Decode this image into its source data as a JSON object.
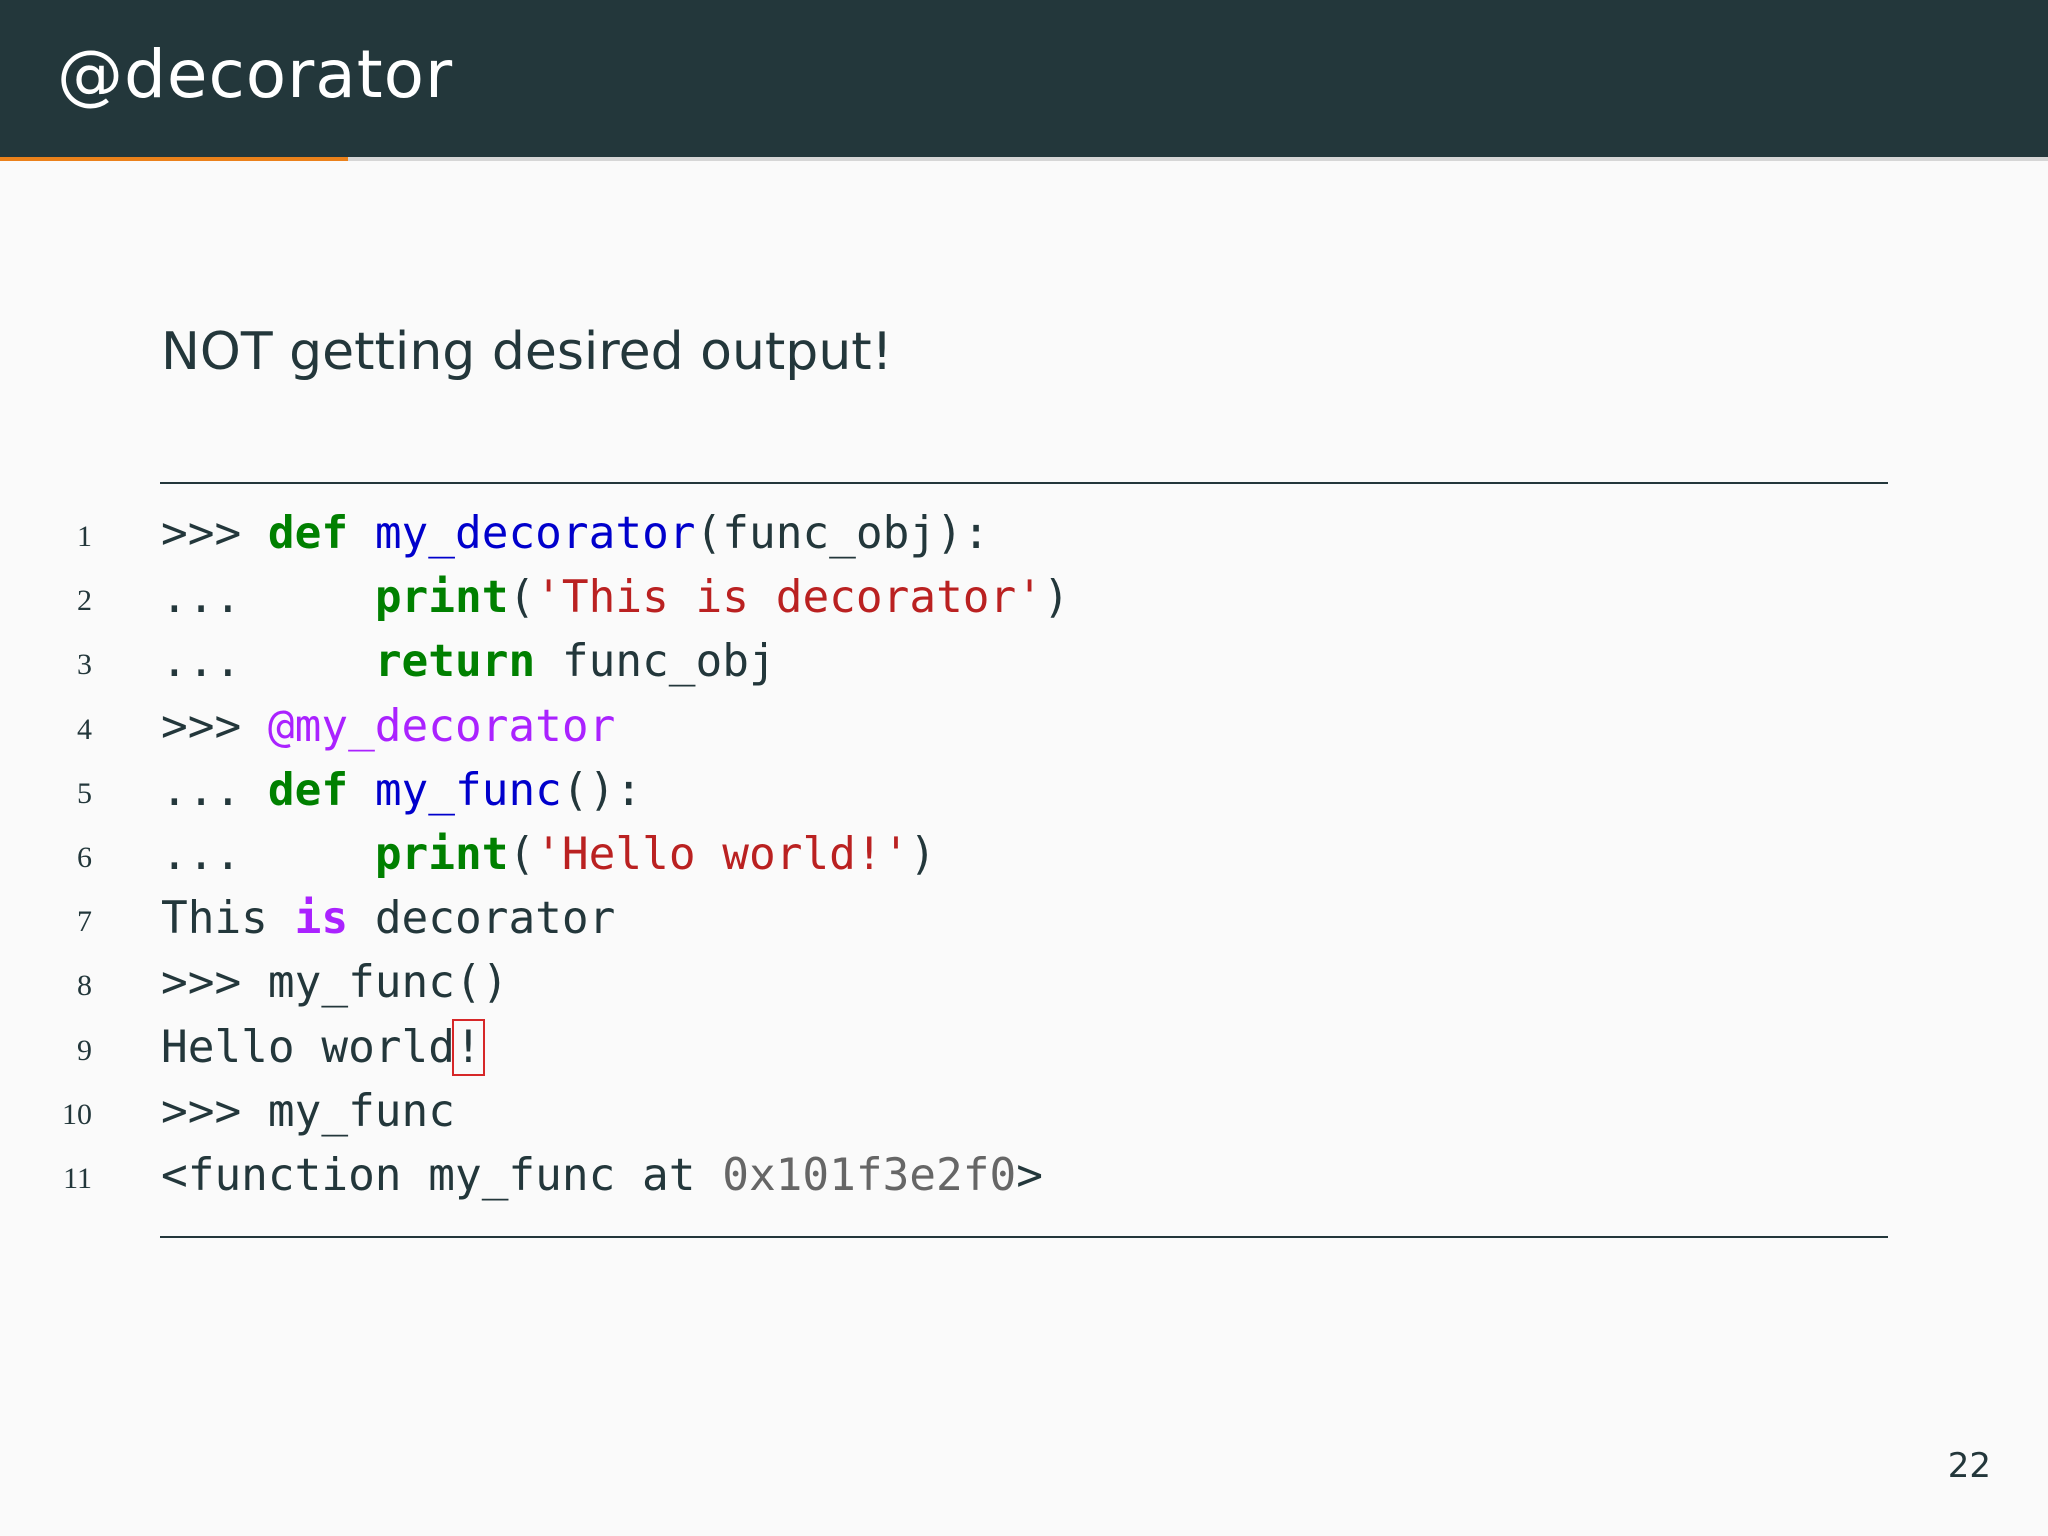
{
  "slide": {
    "title": "@decorator",
    "subtitle": "NOT getting desired output!",
    "page_number": "22",
    "progress": 0.17
  },
  "colors": {
    "header_bg": "#23373b",
    "progress_accent": "#eb811b",
    "keyword": "#008000",
    "function_name": "#0000cc",
    "string": "#ba2121",
    "decorator": "#aa22ff",
    "number": "#666666",
    "highlight_box": "#d62728"
  },
  "code": {
    "lines": [
      {
        "no": "1",
        "tokens": [
          {
            "t": "p",
            "v": ">>> "
          },
          {
            "t": "k",
            "v": "def"
          },
          {
            "t": "p",
            "v": " "
          },
          {
            "t": "n",
            "v": "my_decorator"
          },
          {
            "t": "p",
            "v": "(func_obj):"
          }
        ]
      },
      {
        "no": "2",
        "tokens": [
          {
            "t": "p",
            "v": "...     "
          },
          {
            "t": "k",
            "v": "print"
          },
          {
            "t": "p",
            "v": "("
          },
          {
            "t": "s",
            "v": "'This is decorator'"
          },
          {
            "t": "p",
            "v": ")"
          }
        ]
      },
      {
        "no": "3",
        "tokens": [
          {
            "t": "p",
            "v": "...     "
          },
          {
            "t": "k",
            "v": "return"
          },
          {
            "t": "p",
            "v": " func_obj"
          }
        ]
      },
      {
        "no": "4",
        "tokens": [
          {
            "t": "p",
            "v": ">>> "
          },
          {
            "t": "d",
            "v": "@my_decorator"
          }
        ]
      },
      {
        "no": "5",
        "tokens": [
          {
            "t": "p",
            "v": "... "
          },
          {
            "t": "k",
            "v": "def"
          },
          {
            "t": "p",
            "v": " "
          },
          {
            "t": "n",
            "v": "my_func"
          },
          {
            "t": "p",
            "v": "():"
          }
        ]
      },
      {
        "no": "6",
        "tokens": [
          {
            "t": "p",
            "v": "...     "
          },
          {
            "t": "k",
            "v": "print"
          },
          {
            "t": "p",
            "v": "("
          },
          {
            "t": "s",
            "v": "'Hello world!'"
          },
          {
            "t": "p",
            "v": ")"
          }
        ]
      },
      {
        "no": "7",
        "tokens": [
          {
            "t": "p",
            "v": "This "
          },
          {
            "t": "ow",
            "v": "is"
          },
          {
            "t": "p",
            "v": " decorator"
          }
        ]
      },
      {
        "no": "8",
        "tokens": [
          {
            "t": "p",
            "v": ">>> my_func()"
          }
        ]
      },
      {
        "no": "9",
        "tokens": [
          {
            "t": "p",
            "v": "Hello world"
          },
          {
            "t": "boxed",
            "v": "!"
          }
        ]
      },
      {
        "no": "10",
        "tokens": [
          {
            "t": "p",
            "v": ">>> my_func"
          }
        ]
      },
      {
        "no": "11",
        "tokens": [
          {
            "t": "p",
            "v": "<function my_func at "
          },
          {
            "t": "num",
            "v": "0x101f3e2f0"
          },
          {
            "t": "p",
            "v": ">"
          }
        ]
      }
    ]
  }
}
